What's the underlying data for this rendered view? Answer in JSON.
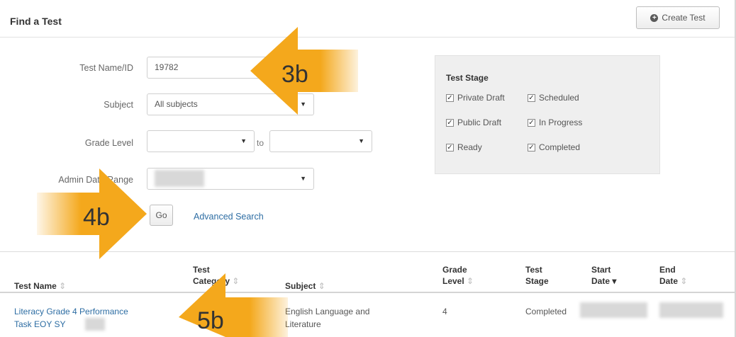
{
  "panel": {
    "title": "Find a Test",
    "create_label": "Create Test"
  },
  "form": {
    "test_name_label": "Test Name/ID",
    "test_name_value": "19782",
    "subject_label": "Subject",
    "subject_value": "All subjects",
    "grade_label": "Grade Level",
    "grade_to": "to",
    "admin_label": "Admin Date Range",
    "go_label": "Go",
    "advanced_label": "Advanced Search"
  },
  "stage": {
    "title": "Test Stage",
    "options": [
      "Private Draft",
      "Scheduled",
      "Public Draft",
      "In Progress",
      "Ready",
      "Completed"
    ],
    "checked": [
      true,
      true,
      true,
      true,
      true,
      true
    ]
  },
  "table": {
    "headers": {
      "name": "Test Name",
      "category_1": "Test",
      "category_2": "Category",
      "subject": "Subject",
      "grade_1": "Grade",
      "grade_2": "Level",
      "stage_1": "Test",
      "stage_2": "Stage",
      "start_1": "Start",
      "start_2": "Date",
      "end_1": "End",
      "end_2": "Date"
    },
    "rows": [
      {
        "name_1": "Literacy Grade 4 Performance",
        "name_2": "Task EOY SY",
        "subject_1": "English Language and",
        "subject_2": "Literature",
        "grade": "4",
        "stage": "Completed"
      }
    ]
  },
  "callouts": {
    "a": "3b",
    "b": "4b",
    "c": "5b"
  },
  "colors": {
    "arrow": "#f4a81c",
    "link": "#2d6da3"
  },
  "icons": {
    "create": "plus-circle-icon",
    "sort": "sort-icon",
    "sort_desc": "sort-desc-icon",
    "caret": "chevron-down-icon"
  }
}
